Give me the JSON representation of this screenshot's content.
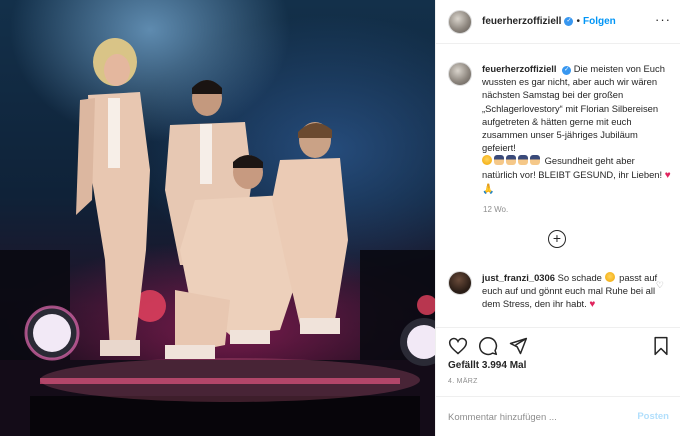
{
  "post": {
    "username": "feuerherzoffiziell",
    "verified_icon": "verified-badge-icon",
    "separator": "•",
    "follow_label": "Folgen",
    "more_icon": "more-options-icon",
    "more_label": "···"
  },
  "caption": {
    "username": "feuerherzoffiziell",
    "text_part1": "Die meisten von Euch wussten es gar nicht, aber auch wir wären nächsten Samstag bei der großen „Schlagerlovestory“ mit Florian Silbereisen aufgetreten & hätten gerne mit euch zusammen unser 5-jähriges Jubiläum gefeiert!",
    "text_part2": "Gesundheit geht aber natürlich vor! BLEIBT GESUND, ihr Lieben!",
    "emojis_1": [
      "sad-face-emoji",
      "police-officer-emoji",
      "police-officer-emoji",
      "police-officer-emoji",
      "police-officer-emoji"
    ],
    "emojis_2": [
      "red-heart-emoji",
      "praying-hands-emoji"
    ],
    "heart_glyph": "♥",
    "pray_glyph": "🙏",
    "time_ago": "12 Wo."
  },
  "load_more_label": "+",
  "comment": {
    "username": "just_franzi_0306",
    "text": "So schade",
    "text_part2": "passt auf euch auf und gönnt euch mal Ruhe bei all dem Stress, den ihr habt.",
    "heart_glyph": "♥",
    "like_glyph": "♡"
  },
  "actions": {
    "like_icon": "heart-icon",
    "comment_icon": "comment-icon",
    "share_icon": "share-icon",
    "save_icon": "bookmark-icon"
  },
  "likes_text": "Gefällt 3.994 Mal",
  "date_text": "4. MÄRZ",
  "add_comment": {
    "placeholder": "Kommentar hinzufügen ...",
    "post_label": "Posten"
  },
  "colors": {
    "accent": "#0095f6",
    "post_disabled": "#b2dffc",
    "heart": "#e0245e",
    "muted": "#8e8e8e"
  }
}
